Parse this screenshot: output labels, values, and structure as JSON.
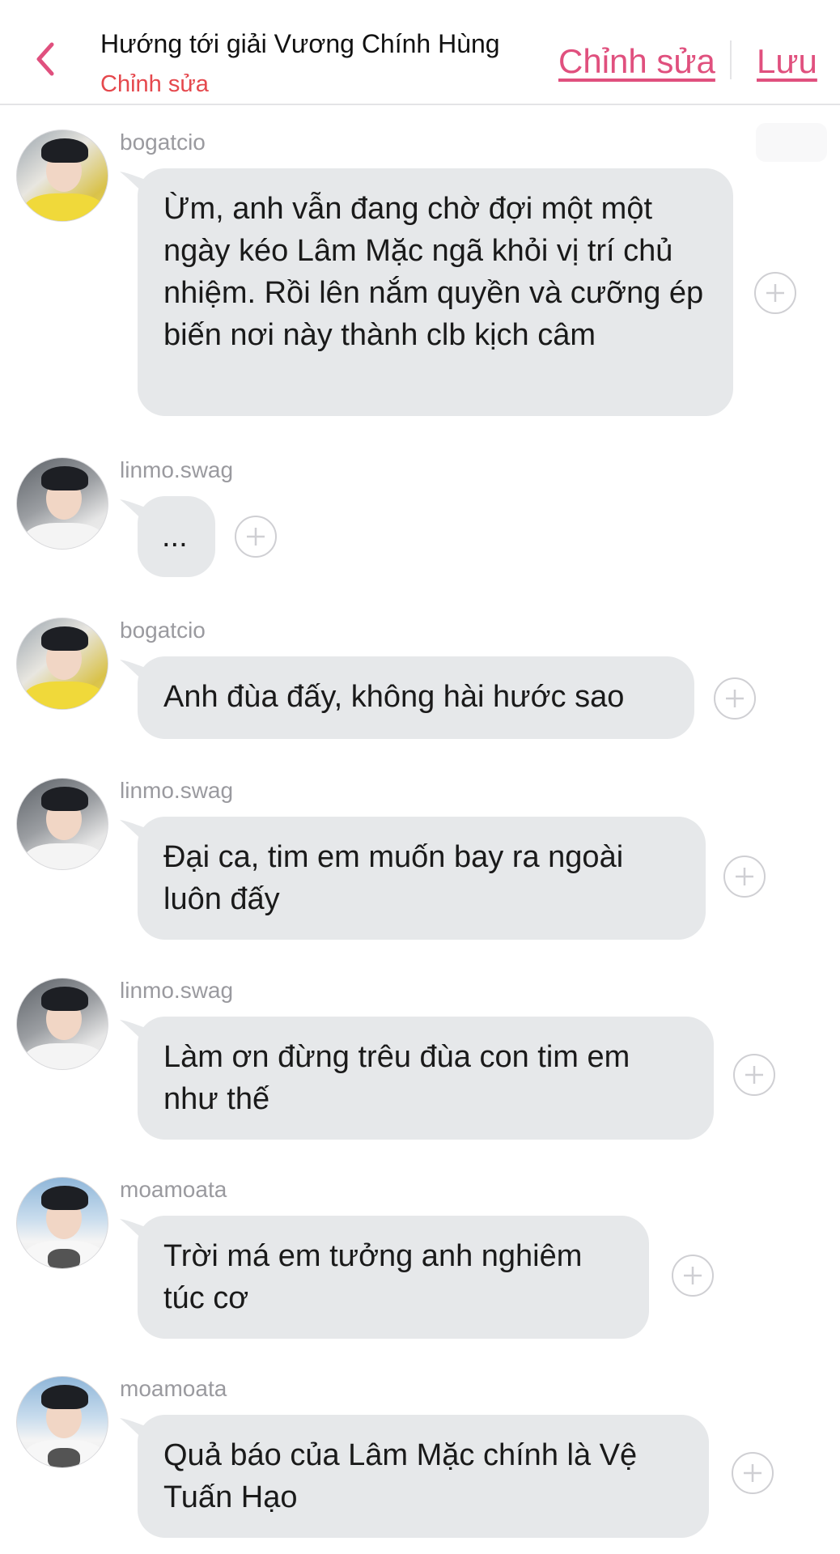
{
  "header": {
    "title": "Hướng tới giải Vương Chính Hùng",
    "subtitle": "Chỉnh sửa",
    "edit_label": "Chỉnh sửa",
    "save_label": "Lưu"
  },
  "colors": {
    "accent": "#e0507e",
    "subtitle": "#e5484d",
    "bubble": "#e6e8ea",
    "username": "#9a9a9f"
  },
  "messages": [
    {
      "username": "bogatcio",
      "text": "Ừm, anh vẫn đang chờ đợi một một ngày kéo Lâm Mặc ngã khỏi vị trí chủ nhiệm. Rồi lên nắm quyền và cưỡng ép biến nơi này thành clb kịch câm"
    },
    {
      "username": "linmo.swag",
      "text": "..."
    },
    {
      "username": "bogatcio",
      "text": "Anh đùa đấy, không hài hước sao"
    },
    {
      "username": "linmo.swag",
      "text": "Đại ca, tim em muốn bay ra ngoài luôn đấy"
    },
    {
      "username": "linmo.swag",
      "text": "Làm ơn đừng trêu đùa con tim em như thế"
    },
    {
      "username": "moamoata",
      "text": "Trời má em tưởng anh nghiêm túc cơ"
    },
    {
      "username": "moamoata",
      "text": "Quả báo của Lâm Mặc chính là Vệ Tuấn Hạo"
    }
  ]
}
